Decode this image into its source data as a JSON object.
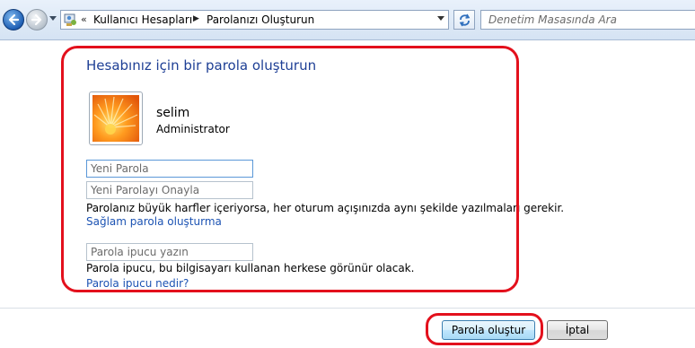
{
  "toolbar": {
    "back_icon": "back-arrow-icon",
    "forward_icon": "forward-arrow-icon",
    "breadcrumb": [
      "Kullanıcı Hesapları",
      "Parolanızı Oluşturun"
    ],
    "search_placeholder": "Denetim Masasında Ara"
  },
  "main": {
    "title": "Hesabınız için bir parola oluşturun",
    "user": {
      "name": "selim",
      "role": "Administrator"
    },
    "new_password_placeholder": "Yeni Parola",
    "confirm_password_placeholder": "Yeni Parolayı Onayla",
    "case_note": "Parolanız büyük harfler içeriyorsa, her oturum açışınızda aynı şekilde yazılmaları gerekir.",
    "strong_password_link": "Sağlam parola oluşturma",
    "hint_placeholder": "Parola ipucu yazın",
    "hint_note": "Parola ipucu, bu bilgisayarı kullanan herkese görünür olacak.",
    "hint_link": "Parola ipucu nedir?"
  },
  "footer": {
    "create_button": "Parola oluştur",
    "cancel_button": "İptal"
  },
  "colors": {
    "title_blue": "#1e3f95",
    "link_blue": "#1c53b3",
    "highlight_red": "#e3101c"
  }
}
